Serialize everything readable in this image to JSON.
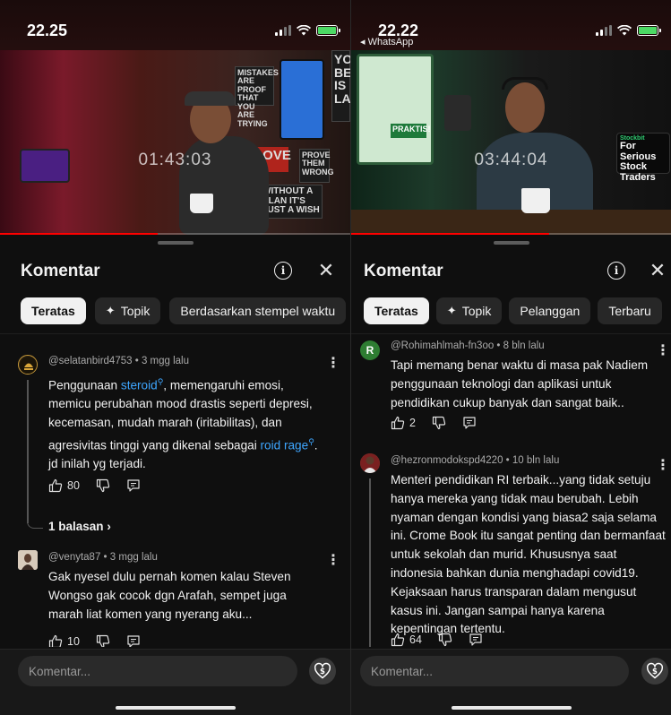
{
  "left": {
    "status": {
      "time": "22.25",
      "back": ""
    },
    "video": {
      "timestamp": "01:43:03",
      "played": 0.45,
      "posters": [
        "MISTAKES ARE PROOF THAT YOU ARE TRYING",
        "PROVE THEM WRONG",
        "WITHOUT A PLAN IT'S JUST A WISH",
        "LOVE",
        "YO BE IS LA"
      ]
    },
    "sheet": {
      "title": "Komentar",
      "chips": [
        {
          "label": "Teratas",
          "active": true
        },
        {
          "label": "Topik",
          "icon": "spark-icon"
        },
        {
          "label": "Berdasarkan stempel waktu"
        }
      ],
      "comments": [
        {
          "author": "@selatanbird4753",
          "time": "3 mgg lalu",
          "text_parts": [
            "Penggunaan ",
            "steroid",
            ", memengaruhi emosi, memicu perubahan mood drastis seperti depresi, kecemasan, mudah marah (iritabilitas), dan agresivitas tinggi yang dikenal sebagai ",
            "roid rage",
            ". jd inilah yg terjadi."
          ],
          "likes": "80",
          "replies": "1 balasan"
        },
        {
          "author": "@venyta87",
          "time": "3 mgg lalu",
          "text": "Gak nyesel dulu pernah komen kalau Steven Wongso gak cocok dgn Arafah, sempet juga marah liat komen yang nyerang aku...",
          "likes": "10"
        }
      ],
      "input_placeholder": "Komentar..."
    }
  },
  "right": {
    "status": {
      "time": "22.22",
      "back": "◂ WhatsApp"
    },
    "video": {
      "timestamp": "03:44:04",
      "played": 0.62,
      "card_text": "For Serious Stock Traders",
      "card_brand": "Stockbit",
      "badge": "PRAKTIS!"
    },
    "sheet": {
      "title": "Komentar",
      "chips": [
        {
          "label": "Teratas",
          "active": true
        },
        {
          "label": "Topik",
          "icon": "spark-icon"
        },
        {
          "label": "Pelanggan"
        },
        {
          "label": "Terbaru"
        }
      ],
      "comments": [
        {
          "author": "@Rohimahlmah-fn3oo",
          "time": "8 bln lalu",
          "avatar_letter": "R",
          "text": "Tapi memang benar waktu di masa pak Nadiem penggunaan teknologi dan aplikasi untuk pendidikan cukup banyak dan sangat baik..",
          "likes": "2"
        },
        {
          "author": "@hezronmodokspd4220",
          "time": "10 bln lalu",
          "text": "Menteri pendidikan RI terbaik...yang tidak setuju hanya mereka yang tidak mau berubah. Lebih nyaman dengan kondisi yang biasa2 saja selama ini. Crome Book itu sangat penting dan bermanfaat untuk sekolah dan murid. Khususnya saat indonesia bahkan dunia menghadapi covid19. Kejaksaan harus transparan dalam mengusut kasus ini. Jangan sampai hanya karena kepentingan tertentu.",
          "likes": "64"
        }
      ],
      "input_placeholder": "Komentar..."
    }
  },
  "colors": {
    "link": "#3ea6ff",
    "background": "#0f0f0f",
    "chip": "#272727",
    "chip_active": "#f1f1f1",
    "avatar_r": "#2e7d32"
  }
}
